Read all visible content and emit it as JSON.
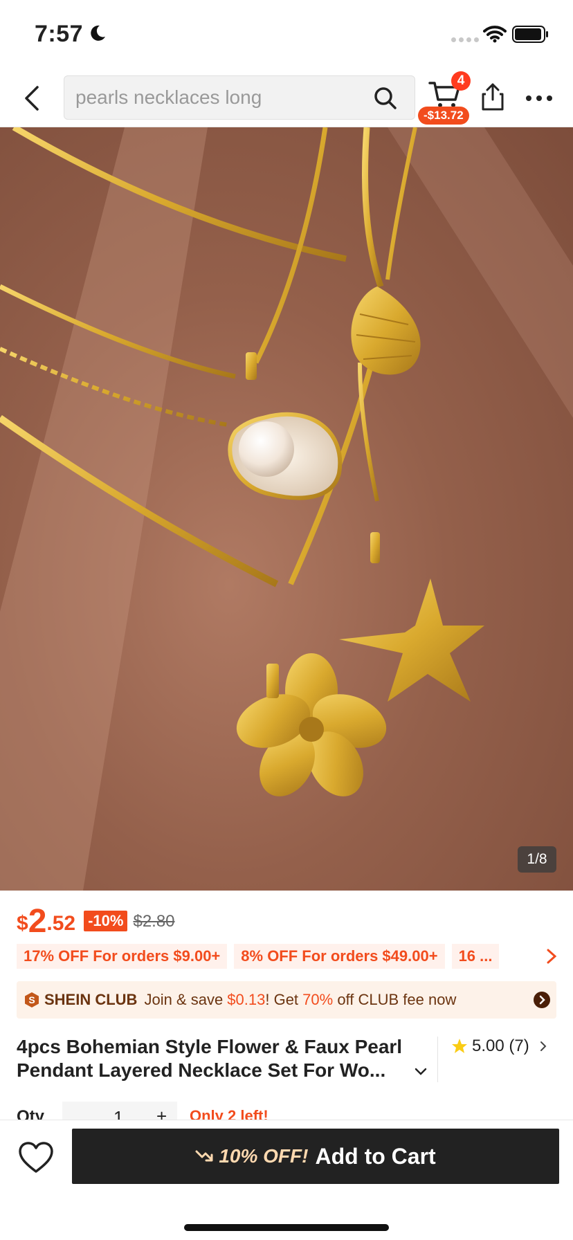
{
  "status": {
    "time": "7:57"
  },
  "search": {
    "placeholder": "pearls necklaces long"
  },
  "cart": {
    "count": "4",
    "price": "-$13.72"
  },
  "gallery": {
    "counter": "1/8"
  },
  "price": {
    "currency": "$",
    "integer": "2",
    "decimal": ".52",
    "discount": "-10%",
    "original": "$2.80"
  },
  "coupons": [
    "17% OFF For orders $9.00+",
    "8% OFF For orders $49.00+",
    "16 ..."
  ],
  "club": {
    "title": "SHEIN CLUB",
    "text_a": "Join & save ",
    "save": "$0.13",
    "text_b": "! Get ",
    "pct": "70%",
    "text_c": " off CLUB fee now"
  },
  "product": {
    "title": "4pcs Bohemian Style Flower & Faux Pearl Pendant Layered Necklace Set For Wo...",
    "rating": "5.00",
    "reviews": "(7)"
  },
  "qty": {
    "label": "Qty",
    "value": "1",
    "plus": "+",
    "stock": "Only 2 left!"
  },
  "bottom": {
    "off": "10% OFF!",
    "add": "Add to Cart"
  },
  "colors": {
    "accent": "#f24c1d",
    "button": "#222222",
    "gold": "#d9a92e"
  },
  "icons": [
    "moon-icon",
    "wifi-icon",
    "battery-icon",
    "back-icon",
    "search-icon",
    "cart-icon",
    "share-icon",
    "more-icon",
    "star-icon",
    "heart-icon",
    "trend-icon"
  ]
}
